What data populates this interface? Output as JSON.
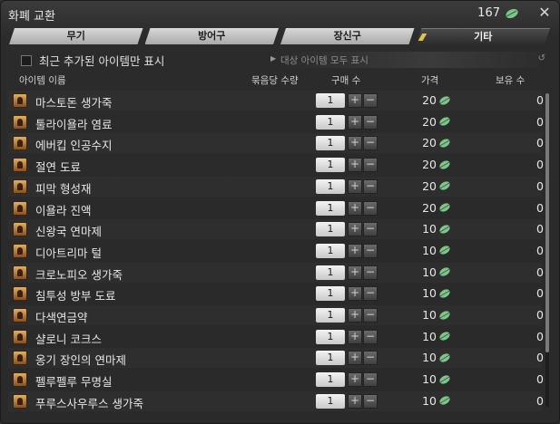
{
  "window": {
    "title": "화폐 교환",
    "currency_amount": "167",
    "currency_icon": "leaf-currency-icon"
  },
  "tabs": [
    {
      "label": "무기",
      "active": false
    },
    {
      "label": "방어구",
      "active": false
    },
    {
      "label": "장신구",
      "active": false
    },
    {
      "label": "기타",
      "active": true
    }
  ],
  "filter": {
    "recent_only_label": "최근 추가된 아이템만 표시",
    "show_all_targets_label": "대상 아이템 모두 표시"
  },
  "columns": {
    "name": "아이템 이름",
    "bundle_qty": "묶음당 수량",
    "buy_qty": "구매 수",
    "price": "가격",
    "owned": "보유 수"
  },
  "items": [
    {
      "name": "마스토돈 생가죽",
      "qty": "1",
      "price": "20",
      "owned": "0"
    },
    {
      "name": "툴라이욜라 염료",
      "qty": "1",
      "price": "20",
      "owned": "0"
    },
    {
      "name": "에버킵 인공수지",
      "qty": "1",
      "price": "20",
      "owned": "0"
    },
    {
      "name": "절연 도료",
      "qty": "1",
      "price": "20",
      "owned": "0"
    },
    {
      "name": "피막 형성재",
      "qty": "1",
      "price": "20",
      "owned": "0"
    },
    {
      "name": "이욜라 진액",
      "qty": "1",
      "price": "20",
      "owned": "0"
    },
    {
      "name": "신왕국 연마제",
      "qty": "1",
      "price": "10",
      "owned": "0"
    },
    {
      "name": "디아트리마 털",
      "qty": "1",
      "price": "10",
      "owned": "0"
    },
    {
      "name": "크로노피오 생가죽",
      "qty": "1",
      "price": "10",
      "owned": "0"
    },
    {
      "name": "침투성 방부 도료",
      "qty": "1",
      "price": "10",
      "owned": "0"
    },
    {
      "name": "다색연금약",
      "qty": "1",
      "price": "10",
      "owned": "0"
    },
    {
      "name": "샬로니 코크스",
      "qty": "1",
      "price": "10",
      "owned": "0"
    },
    {
      "name": "옹기 장인의 연마제",
      "qty": "1",
      "price": "10",
      "owned": "0"
    },
    {
      "name": "펠루펠루 무명실",
      "qty": "1",
      "price": "10",
      "owned": "0"
    },
    {
      "name": "푸루스사우루스 생가죽",
      "qty": "1",
      "price": "10",
      "owned": "0"
    }
  ],
  "colors": {
    "leaf": "#7fc48a",
    "accent_tab_mark": "#e2c34a"
  }
}
